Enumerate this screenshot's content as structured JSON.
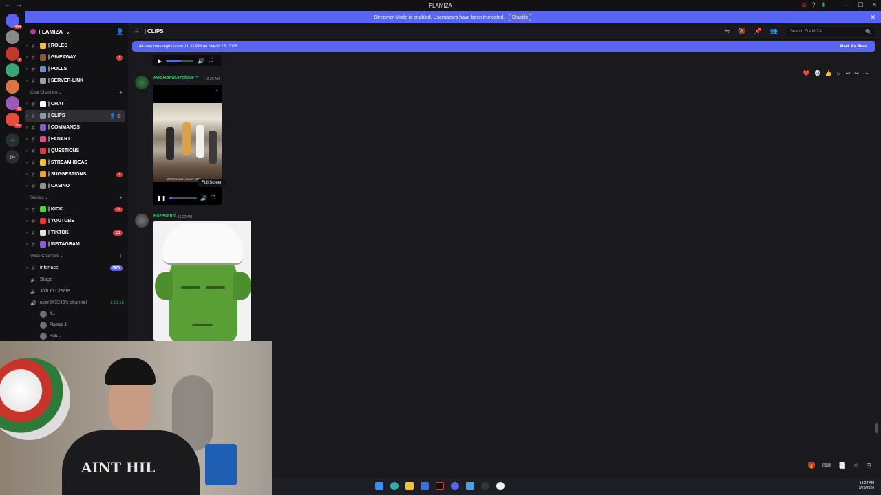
{
  "window": {
    "title": "FLAMIZA",
    "nav_back": "←",
    "nav_forward": "→",
    "controls": {
      "minimize": "—",
      "maximize": "☐",
      "close": "✕"
    },
    "title_icons": [
      "⧉",
      "?",
      "⬇"
    ]
  },
  "banner": {
    "text": "Streamer Mode is enabled. Usernames have been truncated.",
    "button": "Disable",
    "close": "✕"
  },
  "servers": [
    {
      "color": "#5865f2",
      "badge": "444",
      "icon": "discord-home-icon"
    },
    {
      "color": "#888888",
      "badge": "",
      "icon": "server-icon"
    },
    {
      "color": "#c0392b",
      "badge": "2",
      "icon": "server-icon"
    },
    {
      "color": "#3aa676",
      "badge": "",
      "icon": "server-icon"
    },
    {
      "color": "#d97742",
      "badge": "",
      "icon": "server-icon"
    },
    {
      "color": "#9b59b6",
      "badge": "49",
      "icon": "server-icon"
    },
    {
      "color": "#e74c3c",
      "badge": "167",
      "icon": "server-icon"
    }
  ],
  "sidebar": {
    "server_name": "FLAMIZA",
    "server_chevron": "⌄",
    "add_member_icon": "👤",
    "channels_top": [
      {
        "name": "| ROLES",
        "color": "#e8c34a",
        "count": ""
      },
      {
        "name": "| GIVEAWAY",
        "color": "#8a5a3c",
        "count": "1"
      },
      {
        "name": "| POLLS",
        "color": "#6e8bc4",
        "count": ""
      },
      {
        "name": "| SERVER-LINK",
        "color": "#9aa0a6",
        "count": ""
      }
    ],
    "category_chat": "Chat Channels ⌄",
    "channels_chat": [
      {
        "name": "| CHAT",
        "color": "#ffffff",
        "count": ""
      },
      {
        "name": "| CLIPS",
        "color": "#8e9ba8",
        "count": "",
        "active": true
      },
      {
        "name": "| COMMANDS",
        "color": "#7b61c9",
        "count": ""
      },
      {
        "name": "| FANART",
        "color": "#d94f8a",
        "count": ""
      },
      {
        "name": "| QUESTIONS",
        "color": "#d93d3d",
        "count": ""
      },
      {
        "name": "| STREAM-IDEAS",
        "color": "#f2c230",
        "count": ""
      },
      {
        "name": "| SUGGESTIONS",
        "color": "#e6a640",
        "count": "1"
      },
      {
        "name": "| CASINO",
        "color": "#8c8f96",
        "count": ""
      }
    ],
    "category_socials": "Socials ⌄",
    "channels_socials": [
      {
        "name": "| KICK",
        "color": "#53d036",
        "count": "39"
      },
      {
        "name": "| YOUTUBE",
        "color": "#e53935",
        "count": ""
      },
      {
        "name": "| TIKTOK",
        "color": "#e0e0e0",
        "count": "111"
      },
      {
        "name": "| INSTAGRAM",
        "color": "#8e5bd6",
        "count": ""
      }
    ],
    "category_voice": "Voice Channels ⌄",
    "interface_channel": "interface",
    "interface_badge": "NEW",
    "voice": [
      {
        "name": "Stage",
        "time": ""
      },
      {
        "name": "Join to Create",
        "time": ""
      },
      {
        "name": "user243246's channel",
        "time": "1:12:18"
      }
    ],
    "voice_users": [
      "4...",
      "Flames Jr",
      "Hun..."
    ]
  },
  "topbar": {
    "channel": "| CLIPS",
    "icons": [
      "⇋",
      "🔕",
      "📌",
      "👥"
    ],
    "search_placeholder": "Search FLAMIZA",
    "search_icon": "🔍"
  },
  "newbar": {
    "text": "44 new messages since 11:33 PM on March 25, 2026",
    "mark": "Mark As Read"
  },
  "messages": [
    {
      "author": "RedRoninArchive",
      "author_suffix": "™",
      "timestamp": "12:20 AM",
      "video_caption": "AFTERNOON DOOR TIME"
    },
    {
      "author": "Fazesanti",
      "timestamp": "12:22 AM"
    }
  ],
  "video": {
    "tooltip": "Full Screen",
    "progress": 0.12
  },
  "mini_player_progress": 0.55,
  "hover_actions": [
    "❤️",
    "💀",
    "👍",
    "☺",
    "↩",
    "↪",
    "⋯"
  ],
  "webcam": {
    "shirt_text": "AINT HIL"
  },
  "input_icons": [
    "🎁",
    "⌨",
    "📑",
    "☺",
    "⊞"
  ],
  "taskbar": {
    "time": "12:24 AM",
    "date": "3/26/2026"
  }
}
